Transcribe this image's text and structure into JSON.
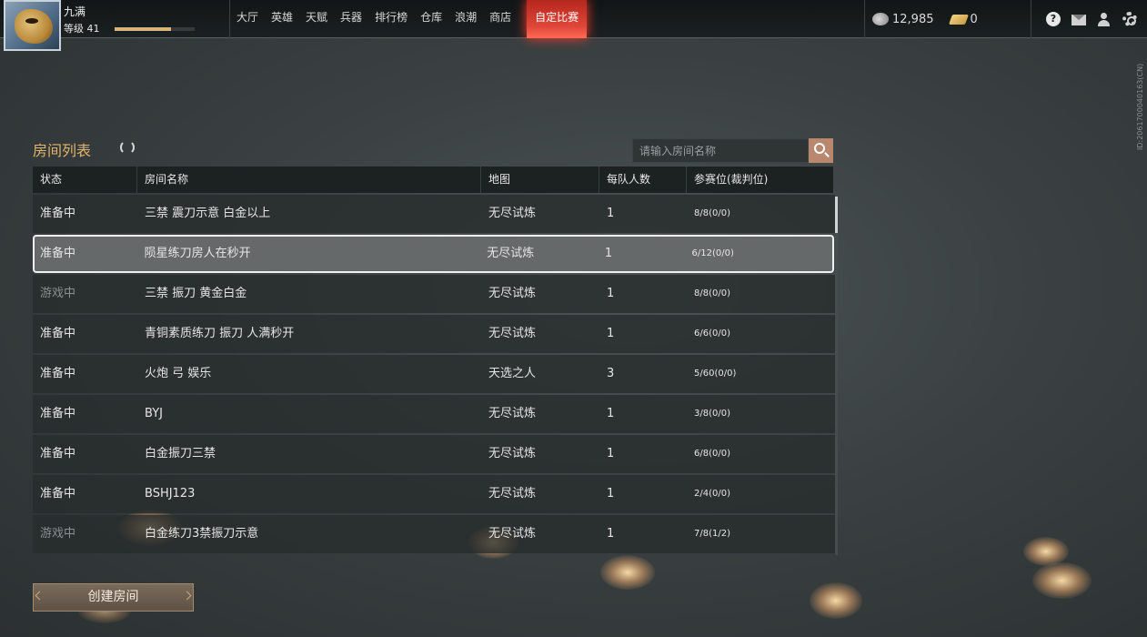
{
  "player": {
    "name": "九满",
    "level_label": "等级 41",
    "xp_fraction": 0.7
  },
  "nav": {
    "items": [
      "大厅",
      "英雄",
      "天赋",
      "兵器",
      "排行榜",
      "仓库",
      "浪潮",
      "商店"
    ],
    "active": "自定比赛"
  },
  "currency": {
    "coins": "12,985",
    "tickets": "0"
  },
  "system": {
    "help": "?"
  },
  "side_id": "ID:2061700040163(CN)",
  "room_list": {
    "title": "房间列表",
    "search_placeholder": "请输入房间名称",
    "columns": {
      "status": "状态",
      "name": "房间名称",
      "map": "地图",
      "team_size": "每队人数",
      "seats": "参赛位(裁判位)"
    },
    "rows": [
      {
        "status": "准备中",
        "name": "三禁  震刀示意 白金以上",
        "map": "无尽试炼",
        "team_size": "1",
        "seats": "8/8(0/0)",
        "playing": false
      },
      {
        "status": "准备中",
        "name": "陨星练刀房人在秒开",
        "map": "无尽试炼",
        "team_size": "1",
        "seats": "6/12(0/0)",
        "playing": false
      },
      {
        "status": "游戏中",
        "name": "三禁 振刀 黄金白金",
        "map": "无尽试炼",
        "team_size": "1",
        "seats": "8/8(0/0)",
        "playing": true
      },
      {
        "status": "准备中",
        "name": "青铜素质练刀 振刀 人满秒开",
        "map": "无尽试炼",
        "team_size": "1",
        "seats": "6/6(0/0)",
        "playing": false
      },
      {
        "status": "准备中",
        "name": "火炮 弓 娱乐",
        "map": "天选之人",
        "team_size": "3",
        "seats": "5/60(0/0)",
        "playing": false
      },
      {
        "status": "准备中",
        "name": "BYJ",
        "map": "无尽试炼",
        "team_size": "1",
        "seats": "3/8(0/0)",
        "playing": false
      },
      {
        "status": "准备中",
        "name": "白金振刀三禁",
        "map": "无尽试炼",
        "team_size": "1",
        "seats": "6/8(0/0)",
        "playing": false
      },
      {
        "status": "准备中",
        "name": "BSHJ123",
        "map": "无尽试炼",
        "team_size": "1",
        "seats": "2/4(0/0)",
        "playing": false
      },
      {
        "status": "游戏中",
        "name": "白金练刀3禁振刀示意",
        "map": "无尽试炼",
        "team_size": "1",
        "seats": "7/8(1/2)",
        "playing": true
      }
    ],
    "selected_index": 1
  },
  "create_button": "创建房间",
  "colors": {
    "accent": "#e0b46a",
    "active_tab": "#e0473a",
    "search_button": "#b9876d"
  }
}
